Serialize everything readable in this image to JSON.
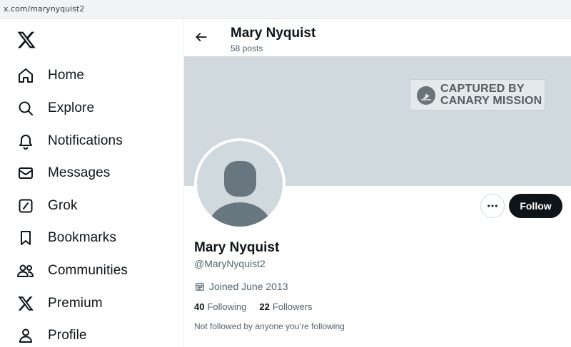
{
  "browser": {
    "url": "x.com/marynyquist2"
  },
  "sidebar": {
    "logo_icon": "x-logo-icon",
    "items": [
      {
        "label": "Home",
        "icon": "home-icon"
      },
      {
        "label": "Explore",
        "icon": "search-icon"
      },
      {
        "label": "Notifications",
        "icon": "bell-icon"
      },
      {
        "label": "Messages",
        "icon": "envelope-icon"
      },
      {
        "label": "Grok",
        "icon": "grok-icon"
      },
      {
        "label": "Bookmarks",
        "icon": "bookmark-icon"
      },
      {
        "label": "Communities",
        "icon": "communities-icon"
      },
      {
        "label": "Premium",
        "icon": "x-logo-icon"
      },
      {
        "label": "Profile",
        "icon": "person-icon"
      }
    ]
  },
  "header": {
    "name": "Mary Nyquist",
    "posts": "58 posts"
  },
  "banner": {
    "badge_line1": "CAPTURED BY",
    "badge_line2": "CANARY MISSION"
  },
  "profile": {
    "name": "Mary Nyquist",
    "handle": "@MaryNyquist2",
    "joined": "Joined June 2013",
    "following_count": "40",
    "following_label": "Following",
    "followers_count": "22",
    "followers_label": "Followers",
    "not_followed": "Not followed by anyone you’re following",
    "follow_label": "Follow"
  },
  "colors": {
    "text": "#0f1419",
    "muted": "#536471",
    "banner": "#cfd9de",
    "button": "#0f1419"
  }
}
